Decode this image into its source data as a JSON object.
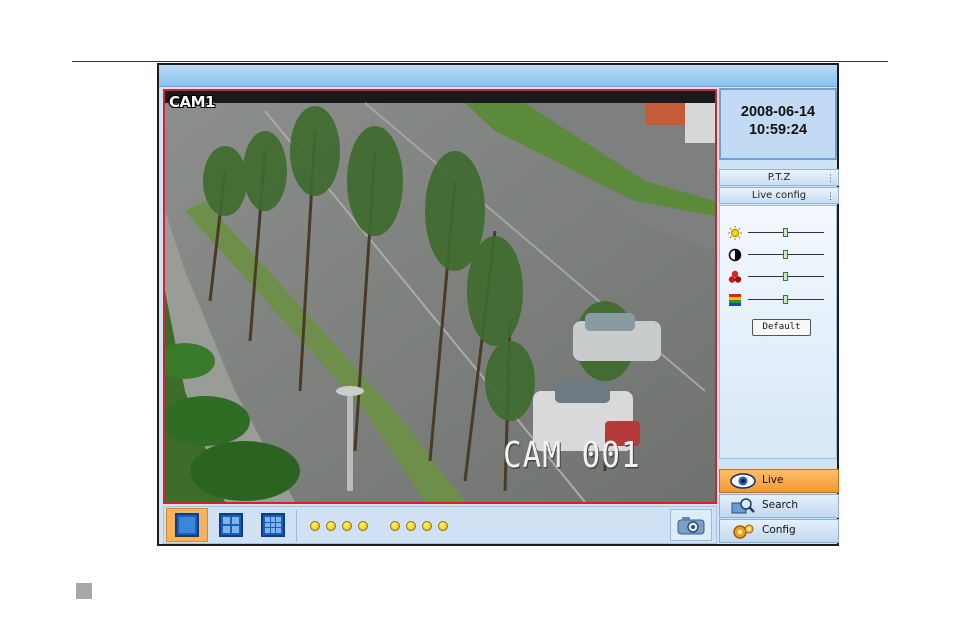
{
  "camera": {
    "corner_label": "CAM1",
    "overlay_label": "CAM 001"
  },
  "datetime": {
    "date": "2008-06-14",
    "time": "10:59:24"
  },
  "menu": {
    "ptz_label": "P.T.Z",
    "live_config_label": "Live config"
  },
  "image_controls": {
    "sliders": [
      {
        "name": "brightness",
        "icon": "sun-icon",
        "value": 0.5
      },
      {
        "name": "contrast",
        "icon": "contrast-icon",
        "value": 0.5
      },
      {
        "name": "saturation",
        "icon": "color-balls-icon",
        "value": 0.5
      },
      {
        "name": "hue",
        "icon": "rainbow-icon",
        "value": 0.5
      }
    ],
    "default_label": "Default"
  },
  "nav": {
    "live_label": "Live",
    "search_label": "Search",
    "config_label": "Config"
  },
  "layouts": {
    "options": [
      "single-view",
      "quad-view",
      "nine-view"
    ],
    "selected": "single-view"
  },
  "channel_dots": {
    "group1_count": 4,
    "group2_count": 4
  },
  "colors": {
    "video_border": "#d4222c",
    "active_nav": "#f39a30",
    "panel_bg": "#cde2f5"
  }
}
